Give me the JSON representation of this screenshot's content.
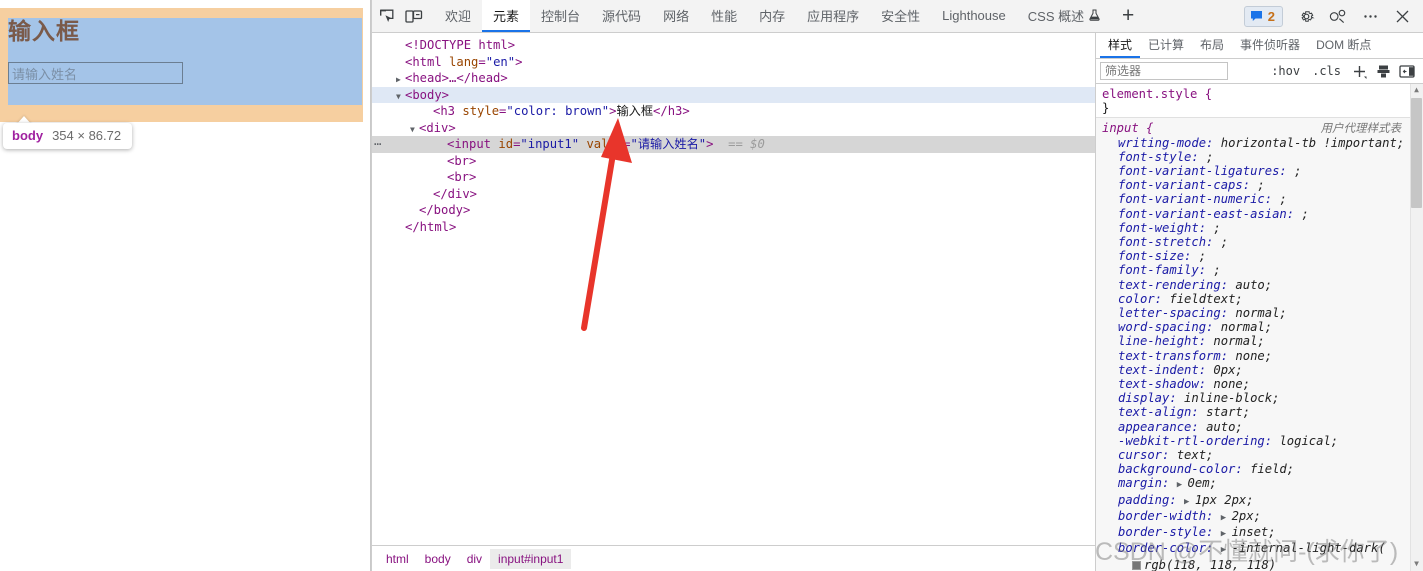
{
  "viewport": {
    "heading": "输入框",
    "input_value": "请输入姓名",
    "badge": {
      "tag": "body",
      "dimensions": "354 × 86.72"
    }
  },
  "devtools": {
    "toolbar_icons": [
      {
        "name": "inspect-element-icon"
      },
      {
        "name": "device-toolbar-icon"
      }
    ],
    "tabs": [
      {
        "label": "欢迎",
        "active": false
      },
      {
        "label": "元素",
        "active": true
      },
      {
        "label": "控制台",
        "active": false
      },
      {
        "label": "源代码",
        "active": false
      },
      {
        "label": "网络",
        "active": false
      },
      {
        "label": "性能",
        "active": false
      },
      {
        "label": "内存",
        "active": false
      },
      {
        "label": "应用程序",
        "active": false
      },
      {
        "label": "安全性",
        "active": false
      },
      {
        "label": "Lighthouse",
        "active": false
      },
      {
        "label": "CSS 概述",
        "active": false
      }
    ],
    "more_tabs_label": "+",
    "issues_count": "2",
    "right_icons": [
      {
        "name": "settings-gear-icon"
      },
      {
        "name": "customize-devtools-icon"
      },
      {
        "name": "more-options-icon"
      },
      {
        "name": "close-devtools-icon"
      }
    ]
  },
  "dom_tree": {
    "lines": [
      {
        "indent": 1,
        "parts": [
          {
            "t": "tg",
            "v": "<!DOCTYPE html>"
          }
        ]
      },
      {
        "indent": 1,
        "parts": [
          {
            "t": "tg",
            "v": "<html "
          },
          {
            "t": "at",
            "v": "lang"
          },
          {
            "t": "tg",
            "v": "="
          },
          {
            "t": "av",
            "v": "\"en\""
          },
          {
            "t": "tg",
            "v": ">"
          }
        ]
      },
      {
        "indent": 1,
        "triangle": "collapsed",
        "parts": [
          {
            "t": "tg",
            "v": "<head>…</head>"
          }
        ]
      },
      {
        "indent": 1,
        "triangle": "expanded",
        "selected": "body",
        "parts": [
          {
            "t": "tg",
            "v": "<body>"
          }
        ]
      },
      {
        "indent": 3,
        "parts": [
          {
            "t": "tg",
            "v": "<h3 "
          },
          {
            "t": "at",
            "v": "style"
          },
          {
            "t": "tg",
            "v": "="
          },
          {
            "t": "av",
            "v": "\"color: brown\""
          },
          {
            "t": "tg",
            "v": ">"
          },
          {
            "t": "txt",
            "v": "输入框"
          },
          {
            "t": "tg",
            "v": "</h3>"
          }
        ]
      },
      {
        "indent": 2,
        "triangle": "expanded",
        "parts": [
          {
            "t": "tg",
            "v": "<div>"
          }
        ]
      },
      {
        "indent": 4,
        "selected": "input",
        "dots": "⋯",
        "parts": [
          {
            "t": "tg",
            "v": "<input "
          },
          {
            "t": "at",
            "v": "id"
          },
          {
            "t": "tg",
            "v": "="
          },
          {
            "t": "av",
            "v": "\"input1\""
          },
          {
            "t": "tg",
            "v": " "
          },
          {
            "t": "at",
            "v": "value"
          },
          {
            "t": "tg",
            "v": "="
          },
          {
            "t": "av",
            "v": "\"请输入姓名\""
          },
          {
            "t": "tg",
            "v": ">"
          },
          {
            "t": "eq",
            "v": "  == $0"
          }
        ]
      },
      {
        "indent": 4,
        "parts": [
          {
            "t": "tg",
            "v": "<br>"
          }
        ]
      },
      {
        "indent": 4,
        "parts": [
          {
            "t": "tg",
            "v": "<br>"
          }
        ]
      },
      {
        "indent": 3,
        "parts": [
          {
            "t": "tg",
            "v": "</div>"
          }
        ]
      },
      {
        "indent": 2,
        "parts": [
          {
            "t": "tg",
            "v": "</body>"
          }
        ]
      },
      {
        "indent": 1,
        "parts": [
          {
            "t": "tg",
            "v": "</html>"
          }
        ]
      }
    ]
  },
  "breadcrumb": [
    {
      "label": "html",
      "active": false
    },
    {
      "label": "body",
      "active": false
    },
    {
      "label": "div",
      "active": false
    },
    {
      "label": "input#input1",
      "active": true
    }
  ],
  "styles": {
    "tabs": [
      {
        "label": "样式",
        "active": true
      },
      {
        "label": "已计算",
        "active": false
      },
      {
        "label": "布局",
        "active": false
      },
      {
        "label": "事件侦听器",
        "active": false
      },
      {
        "label": "DOM 断点",
        "active": false
      }
    ],
    "filter_placeholder": "筛选器",
    "filter_value": "",
    "hov_label": ":hov",
    "cls_label": ".cls",
    "new_rule_label": "+",
    "toolbar_icons": [
      {
        "name": "new-style-rule-icon"
      },
      {
        "name": "element-state-icon"
      },
      {
        "name": "computed-sidebar-toggle-icon"
      }
    ],
    "rules": [
      {
        "selector": "element.style {",
        "origin": "",
        "ua": false,
        "declarations": [],
        "close": "}"
      },
      {
        "selector": "input {",
        "origin": "用户代理样式表",
        "ua": true,
        "close": "",
        "declarations": [
          {
            "prop": "writing-mode",
            "value": "horizontal-tb !important;"
          },
          {
            "prop": "font-style",
            "value": ";"
          },
          {
            "prop": "font-variant-ligatures",
            "value": ";"
          },
          {
            "prop": "font-variant-caps",
            "value": ";"
          },
          {
            "prop": "font-variant-numeric",
            "value": ";"
          },
          {
            "prop": "font-variant-east-asian",
            "value": ";"
          },
          {
            "prop": "font-weight",
            "value": ";"
          },
          {
            "prop": "font-stretch",
            "value": ";"
          },
          {
            "prop": "font-size",
            "value": ";"
          },
          {
            "prop": "font-family",
            "value": ";"
          },
          {
            "prop": "text-rendering",
            "value": "auto;"
          },
          {
            "prop": "color",
            "value": "fieldtext;"
          },
          {
            "prop": "letter-spacing",
            "value": "normal;"
          },
          {
            "prop": "word-spacing",
            "value": "normal;"
          },
          {
            "prop": "line-height",
            "value": "normal;"
          },
          {
            "prop": "text-transform",
            "value": "none;"
          },
          {
            "prop": "text-indent",
            "value": "0px;"
          },
          {
            "prop": "text-shadow",
            "value": "none;"
          },
          {
            "prop": "display",
            "value": "inline-block;"
          },
          {
            "prop": "text-align",
            "value": "start;"
          },
          {
            "prop": "appearance",
            "value": "auto;"
          },
          {
            "prop": "-webkit-rtl-ordering",
            "value": "logical;"
          },
          {
            "prop": "cursor",
            "value": "text;"
          },
          {
            "prop": "background-color",
            "value": "field;"
          },
          {
            "prop": "margin",
            "value": "0em;",
            "expandable": true
          },
          {
            "prop": "padding",
            "value": "1px 2px;",
            "expandable": true
          },
          {
            "prop": "border-width",
            "value": "2px;",
            "expandable": true
          },
          {
            "prop": "border-style",
            "value": "inset;",
            "expandable": true
          },
          {
            "prop": "border-color",
            "value": "-internal-light-dark(",
            "expandable": true
          },
          {
            "prop": "",
            "value": "rgb(118, 118, 118)",
            "swatch": true
          }
        ]
      }
    ]
  },
  "watermark": "CSDN @不懂就问-(求你了)"
}
